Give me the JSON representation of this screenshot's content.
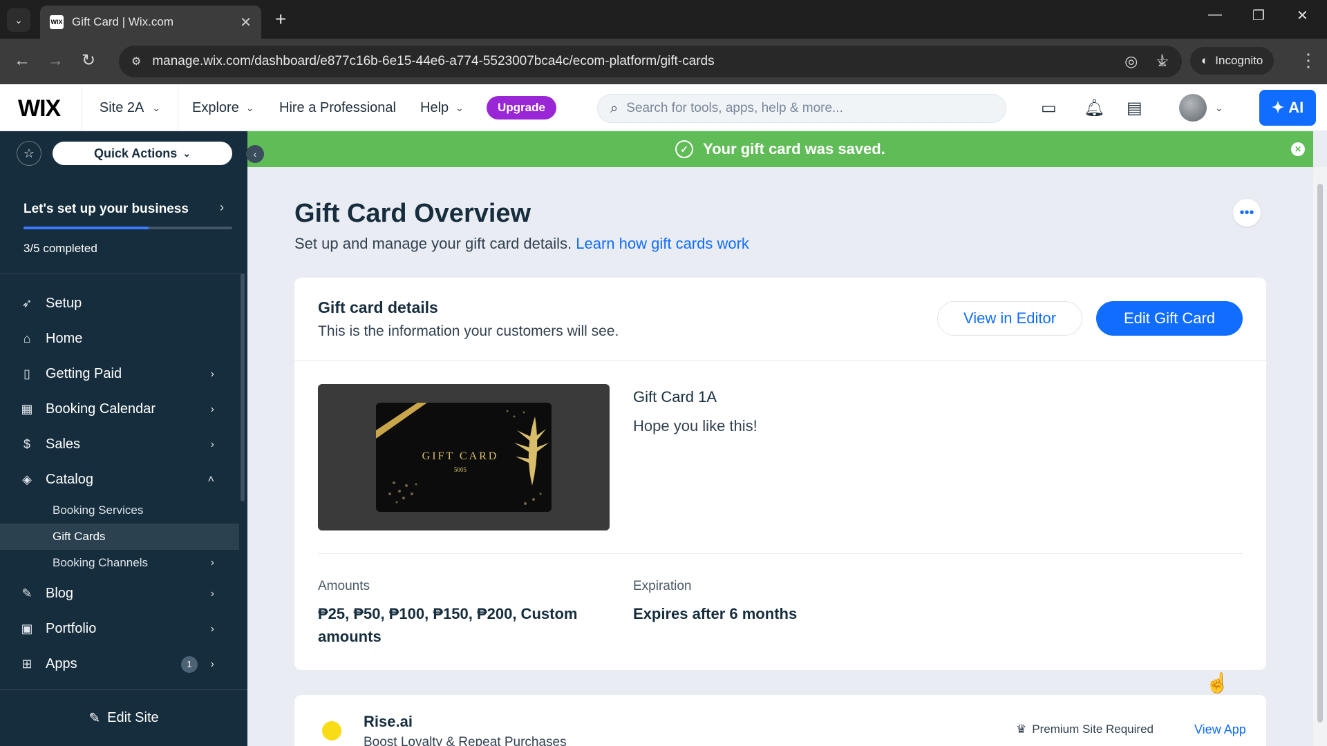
{
  "browser": {
    "tab_title": "Gift Card | Wix.com",
    "favicon_text": "WIX",
    "url": "manage.wix.com/dashboard/e877c16b-6e15-44e6-a774-5523007bca4c/ecom-platform/gift-cards",
    "incognito_label": "Incognito"
  },
  "topbar": {
    "logo": "WIX",
    "site_name": "Site 2A",
    "nav": [
      "Explore",
      "Hire a Professional",
      "Help"
    ],
    "upgrade_label": "Upgrade",
    "search_placeholder": "Search for tools, apps, help & more...",
    "ai_label": "AI"
  },
  "sidebar": {
    "quick_actions": "Quick Actions",
    "setup_title": "Let's set up your business",
    "setup_progress": 0.6,
    "setup_count": "3/5 completed",
    "items": [
      {
        "label": "Setup",
        "icon": "rocket-icon"
      },
      {
        "label": "Home",
        "icon": "home-icon"
      },
      {
        "label": "Getting Paid",
        "icon": "invoice-icon"
      },
      {
        "label": "Booking Calendar",
        "icon": "calendar-icon"
      },
      {
        "label": "Sales",
        "icon": "dollar-icon"
      },
      {
        "label": "Catalog",
        "icon": "tag-icon"
      },
      {
        "label": "Blog",
        "icon": "pen-icon"
      },
      {
        "label": "Portfolio",
        "icon": "portfolio-icon"
      },
      {
        "label": "Apps",
        "icon": "apps-icon",
        "badge": "1"
      }
    ],
    "catalog_sub": [
      "Booking Services",
      "Gift Cards",
      "Booking Channels"
    ],
    "edit_site": "Edit Site"
  },
  "toast": {
    "message": "Your gift card was saved."
  },
  "page": {
    "title": "Gift Card Overview",
    "subtitle": "Set up and manage your gift card details.",
    "learn_link": "Learn how gift cards work"
  },
  "details": {
    "title": "Gift card details",
    "subtitle": "This is the information your customers will see.",
    "view_editor": "View in Editor",
    "edit_gift_card": "Edit Gift Card",
    "card_image_text": "GIFT CARD",
    "card_image_number": "5005",
    "card_name": "Gift Card 1A",
    "card_description": "Hope you like this!",
    "amounts_label": "Amounts",
    "amounts_line1": "₱25, ₱50, ₱100, ₱150, ₱200, Custom",
    "amounts_line2": "amounts",
    "expiration_label": "Expiration",
    "expiration_value": "Expires after 6 months"
  },
  "app_promo": {
    "name": "Rise.ai",
    "tagline": "Boost Loyalty & Repeat Purchases",
    "premium": "Premium Site Required",
    "view_app": "View App"
  },
  "colors": {
    "accent": "#116dff",
    "toast_green": "#60bc57",
    "upgrade_purple": "#9a27d5",
    "sidebar_bg": "#162d3d"
  }
}
